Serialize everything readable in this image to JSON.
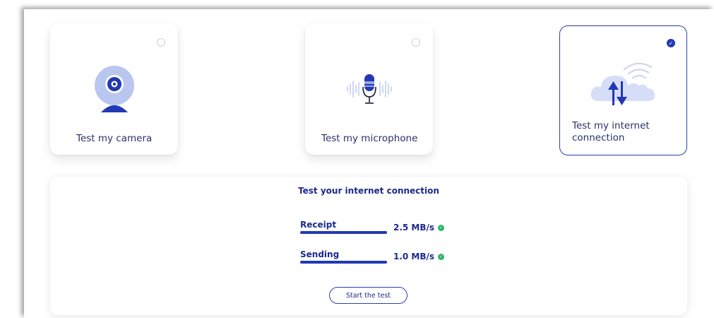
{
  "cards": [
    {
      "label": "Test my camera",
      "icon": "webcam-icon",
      "selected": false
    },
    {
      "label": "Test my microphone",
      "icon": "microphone-icon",
      "selected": false
    },
    {
      "label_line1": "Test my internet",
      "label_line2": "connection",
      "icon": "cloud-upload-download-icon",
      "selected": true
    }
  ],
  "panel": {
    "title": "Test your internet connection",
    "metrics": [
      {
        "label": "Receipt",
        "value": "2.5 MB/s",
        "status": "ok"
      },
      {
        "label": "Sending",
        "value": "1.0 MB/s",
        "status": "ok"
      }
    ],
    "button_label": "Start the test"
  },
  "colors": {
    "primary": "#2238b4",
    "text": "#1c2a8c",
    "success": "#2fb36b",
    "icon_light": "#b9c6ef"
  }
}
